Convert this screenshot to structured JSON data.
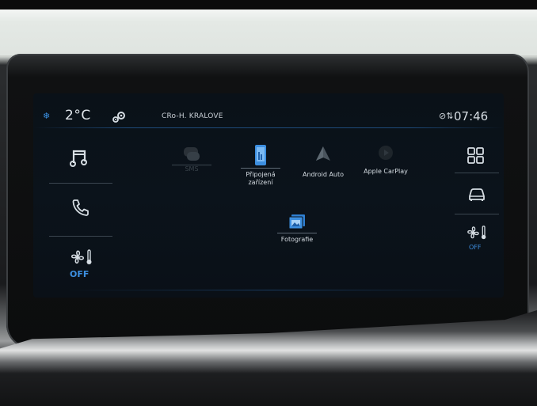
{
  "status_bar": {
    "ac_icon": "snowflake-icon",
    "temperature": "2°C",
    "settings_icon": "gears-icon",
    "radio_station": "CRo-H. KRALOVE",
    "nav_icon": "location-arrows-icon",
    "time": "07:46"
  },
  "left_shortcuts": [
    {
      "icon": "music-note-icon"
    },
    {
      "icon": "phone-icon"
    },
    {
      "icon": "fan-temperature-icon",
      "label": "OFF"
    }
  ],
  "right_shortcuts": [
    {
      "icon": "app-grid-icon"
    },
    {
      "icon": "car-icon"
    },
    {
      "icon": "fan-temperature-icon",
      "label": "OFF"
    }
  ],
  "apps": [
    {
      "label": "SMS",
      "icon": "sms-icon",
      "enabled": false
    },
    {
      "label": "Připojená zařízení",
      "icon": "phone-device-icon",
      "enabled": true
    },
    {
      "label": "Android Auto",
      "icon": "android-auto-icon",
      "enabled": true
    },
    {
      "label": "Apple CarPlay",
      "icon": "apple-carplay-icon",
      "enabled": true
    },
    {
      "label": "Fotografie",
      "icon": "photo-gallery-icon",
      "enabled": true
    }
  ],
  "colors": {
    "accent": "#3d8fe0",
    "text": "#d6dde3",
    "screen_bg": "#0a1118"
  }
}
